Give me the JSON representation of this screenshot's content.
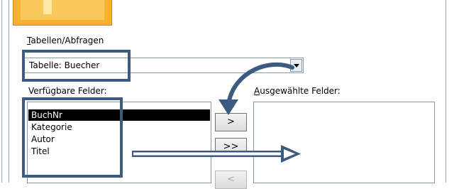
{
  "section_label": "Tabellen/Abfragen",
  "section_label_mnemonic": "T",
  "section_label_rest": "abellen/Abfragen",
  "combo": {
    "value": "Tabelle: Buecher"
  },
  "available_fields_label_mnemonic": "",
  "available_fields_label": "Verfügbare Felder:",
  "selected_fields_label_mnemonic": "A",
  "selected_fields_label_rest": "usgewählte Felder:",
  "fields": [
    "BuchNr",
    "Kategorie",
    "Autor",
    "Titel"
  ],
  "selected_field_index": 0,
  "buttons": {
    "add_one": ">",
    "add_all": ">>",
    "remove_one": "<"
  },
  "colors": {
    "highlight_frame": "#3d5a80",
    "banner": "#f6b12e"
  }
}
